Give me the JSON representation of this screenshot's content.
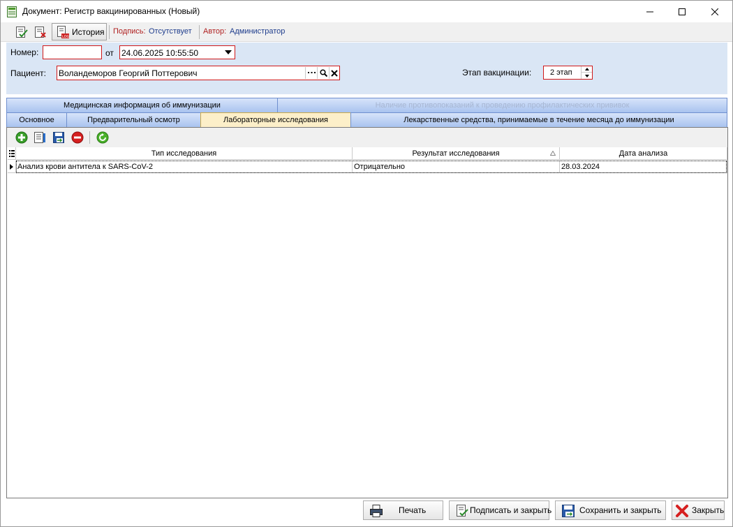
{
  "window": {
    "title": "Документ: Регистр вакцинированных (Новый)"
  },
  "toolbar": {
    "history_label": "История",
    "sign_label": "Подпись:",
    "sign_value": "Отсутствует",
    "author_label": "Автор:",
    "author_value": "Администратор"
  },
  "form": {
    "number_label": "Номер:",
    "number_value": "",
    "from_label": "от",
    "date_value": "24.06.2025 10:55:50",
    "patient_label": "Пациент:",
    "patient_value": "Воландеморов Георгий Поттерович",
    "stage_label": "Этап вакцинации:",
    "stage_value": "2 этап"
  },
  "tabs_row1": [
    {
      "label": "Медицинская информация об иммунизации",
      "enabled": true
    },
    {
      "label": "Наличие противопоказаний к проведению профилактических прививок",
      "enabled": false
    }
  ],
  "tabs_row2": [
    {
      "label": "Основное"
    },
    {
      "label": "Предварительный осмотр"
    },
    {
      "label": "Лабораторные исследования",
      "active": true
    },
    {
      "label": "Лекарственные средства, принимаемые в течение месяца до иммунизации"
    }
  ],
  "grid": {
    "columns": [
      "Тип исследования",
      "Результат исследования",
      "Дата анализа"
    ],
    "rows": [
      [
        "Анализ крови антитела к SARS-CoV-2",
        "Отрицательно",
        "28.03.2024"
      ]
    ]
  },
  "buttons": {
    "print": "Печать",
    "sign_close": "Подписать и закрыть",
    "save_close": "Сохранить и закрыть",
    "close": "Закрыть"
  },
  "colors": {
    "accent_red": "#d01818",
    "tab_blue": "#a9c3ef",
    "tab_active": "#fcefc9",
    "header_bg": "#dae6f5"
  }
}
